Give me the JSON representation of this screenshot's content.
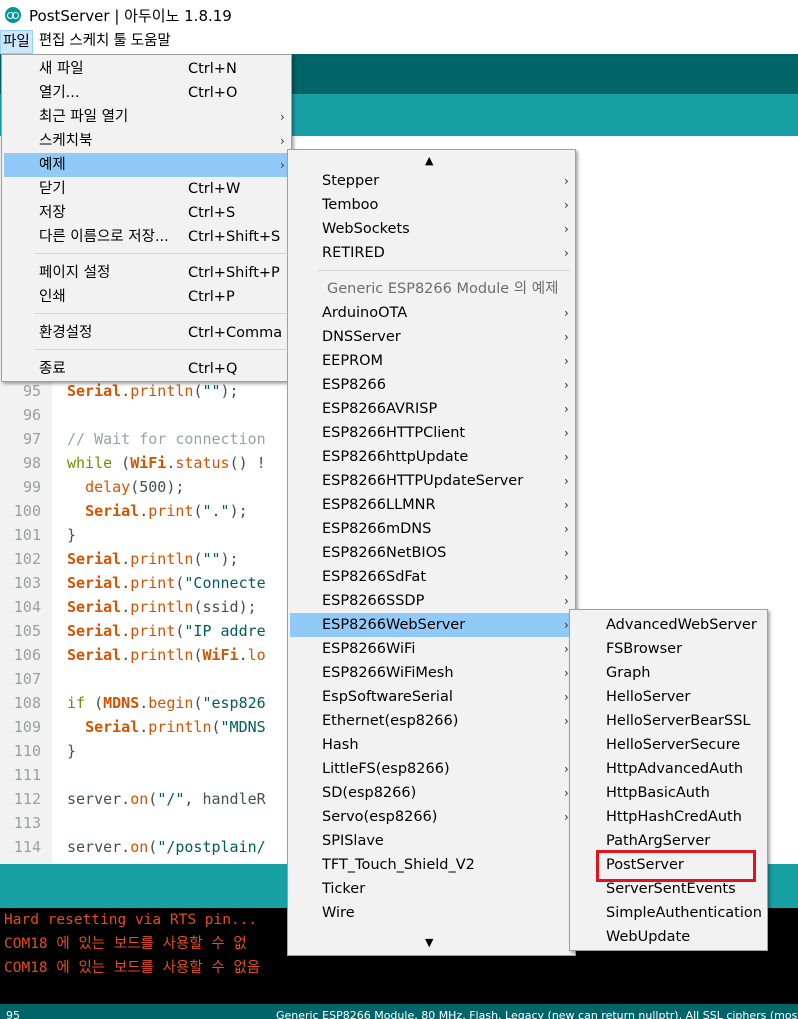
{
  "window": {
    "title": "PostServer | 아두이노 1.8.19"
  },
  "menubar": {
    "items": [
      "파일",
      "편집",
      "스케치",
      "툴",
      "도움말"
    ]
  },
  "editor": {
    "lines": [
      {
        "n": "95",
        "code": [
          [
            "kw-serial",
            "Serial"
          ],
          [
            "",
            "."
          ],
          [
            "kw-fn",
            "println"
          ],
          [
            "",
            "("
          ],
          [
            "str",
            "\"\""
          ],
          [
            "",
            ");"
          ]
        ]
      },
      {
        "n": "96",
        "code": []
      },
      {
        "n": "97",
        "code": [
          [
            "cmt",
            "// Wait for connection"
          ]
        ]
      },
      {
        "n": "98",
        "code": [
          [
            "kw-ctl",
            "while"
          ],
          [
            "",
            " ("
          ],
          [
            "kw-serial",
            "WiFi"
          ],
          [
            "",
            "."
          ],
          [
            "kw-fn",
            "status"
          ],
          [
            "",
            "() !"
          ]
        ]
      },
      {
        "n": "99",
        "code": [
          [
            "",
            "  "
          ],
          [
            "kw-fn",
            "delay"
          ],
          [
            "",
            "(500);"
          ]
        ]
      },
      {
        "n": "100",
        "code": [
          [
            "",
            "  "
          ],
          [
            "kw-serial",
            "Serial"
          ],
          [
            "",
            "."
          ],
          [
            "kw-fn",
            "print"
          ],
          [
            "",
            "("
          ],
          [
            "str",
            "\".\""
          ],
          [
            "",
            ");"
          ]
        ]
      },
      {
        "n": "101",
        "code": [
          [
            "",
            "}"
          ]
        ]
      },
      {
        "n": "102",
        "code": [
          [
            "kw-serial",
            "Serial"
          ],
          [
            "",
            "."
          ],
          [
            "kw-fn",
            "println"
          ],
          [
            "",
            "("
          ],
          [
            "str",
            "\"\""
          ],
          [
            "",
            ");"
          ]
        ]
      },
      {
        "n": "103",
        "code": [
          [
            "kw-serial",
            "Serial"
          ],
          [
            "",
            "."
          ],
          [
            "kw-fn",
            "print"
          ],
          [
            "",
            "("
          ],
          [
            "str",
            "\"Connecte"
          ]
        ]
      },
      {
        "n": "104",
        "code": [
          [
            "kw-serial",
            "Serial"
          ],
          [
            "",
            "."
          ],
          [
            "kw-fn",
            "println"
          ],
          [
            "",
            "(ssid);"
          ]
        ]
      },
      {
        "n": "105",
        "code": [
          [
            "kw-serial",
            "Serial"
          ],
          [
            "",
            "."
          ],
          [
            "kw-fn",
            "print"
          ],
          [
            "",
            "("
          ],
          [
            "str",
            "\"IP addre"
          ]
        ]
      },
      {
        "n": "106",
        "code": [
          [
            "kw-serial",
            "Serial"
          ],
          [
            "",
            "."
          ],
          [
            "kw-fn",
            "println"
          ],
          [
            "",
            "("
          ],
          [
            "kw-serial",
            "WiFi"
          ],
          [
            "",
            "."
          ],
          [
            "kw-fn",
            "lo"
          ]
        ]
      },
      {
        "n": "107",
        "code": []
      },
      {
        "n": "108",
        "code": [
          [
            "kw-ctl",
            "if"
          ],
          [
            "",
            " ("
          ],
          [
            "kw-serial",
            "MDNS"
          ],
          [
            "",
            "."
          ],
          [
            "kw-fn",
            "begin"
          ],
          [
            "",
            "("
          ],
          [
            "str",
            "\"esp826"
          ]
        ]
      },
      {
        "n": "109",
        "code": [
          [
            "",
            "  "
          ],
          [
            "kw-serial",
            "Serial"
          ],
          [
            "",
            "."
          ],
          [
            "kw-fn",
            "println"
          ],
          [
            "",
            "("
          ],
          [
            "str",
            "\"MDNS"
          ]
        ]
      },
      {
        "n": "110",
        "code": [
          [
            "",
            "}"
          ]
        ]
      },
      {
        "n": "111",
        "code": []
      },
      {
        "n": "112",
        "code": [
          [
            "",
            "server."
          ],
          [
            "kw-fn",
            "on"
          ],
          [
            "",
            "("
          ],
          [
            "str",
            "\"/\""
          ],
          [
            "",
            ", handleR"
          ]
        ]
      },
      {
        "n": "113",
        "code": []
      },
      {
        "n": "114",
        "code": [
          [
            "",
            "server."
          ],
          [
            "kw-fn",
            "on"
          ],
          [
            "",
            "("
          ],
          [
            "str",
            "\"/postplain/"
          ]
        ]
      }
    ]
  },
  "console": {
    "lines": [
      "Hard resetting via RTS pin...",
      "COM18 에 있는 보드를 사용할 수 없",
      "COM18 에 있는 보드를 사용할 수 없음"
    ]
  },
  "footer": {
    "line": "95",
    "board": "Generic ESP8266 Module, 80 MHz, Flash, Legacy (new can return nullptr), All SSL ciphers (most"
  },
  "file_menu": {
    "items": [
      {
        "label": "새 파일",
        "shortcut": "Ctrl+N"
      },
      {
        "label": "열기...",
        "shortcut": "Ctrl+O"
      },
      {
        "label": "최근 파일 열기",
        "shortcut": "",
        "submenu": true
      },
      {
        "label": "스케치북",
        "shortcut": "",
        "submenu": true
      },
      {
        "label": "예제",
        "shortcut": "",
        "submenu": true,
        "highlighted": true
      },
      {
        "label": "닫기",
        "shortcut": "Ctrl+W"
      },
      {
        "label": "저장",
        "shortcut": "Ctrl+S"
      },
      {
        "label": "다른 이름으로 저장...",
        "shortcut": "Ctrl+Shift+S"
      },
      {
        "label": "페이지 설정",
        "shortcut": "Ctrl+Shift+P"
      },
      {
        "label": "인쇄",
        "shortcut": "Ctrl+P"
      },
      {
        "label": "환경설정",
        "shortcut": "Ctrl+Comma"
      },
      {
        "label": "종료",
        "shortcut": "Ctrl+Q"
      }
    ]
  },
  "examples_menu": {
    "scroll_up": "▲",
    "scroll_down": "▼",
    "top_items": [
      "Stepper",
      "Temboo",
      "WebSockets",
      "RETIRED"
    ],
    "section_header": "Generic ESP8266 Module 의 예제",
    "board_items": [
      "ArduinoOTA",
      "DNSServer",
      "EEPROM",
      "ESP8266",
      "ESP8266AVRISP",
      "ESP8266HTTPClient",
      "ESP8266httpUpdate",
      "ESP8266HTTPUpdateServer",
      "ESP8266LLMNR",
      "ESP8266mDNS",
      "ESP8266NetBIOS",
      "ESP8266SdFat",
      "ESP8266SSDP",
      "ESP8266WebServer",
      "ESP8266WiFi",
      "ESP8266WiFiMesh",
      "EspSoftwareSerial",
      "Ethernet(esp8266)",
      "Hash",
      "LittleFS(esp8266)",
      "SD(esp8266)",
      "Servo(esp8266)",
      "SPISlave",
      "TFT_Touch_Shield_V2",
      "Ticker",
      "Wire"
    ],
    "highlighted": "ESP8266WebServer",
    "no_arrow": [
      "Hash",
      "SPISlave",
      "TFT_Touch_Shield_V2",
      "Ticker",
      "Wire"
    ]
  },
  "webserver_menu": {
    "items": [
      "AdvancedWebServer",
      "FSBrowser",
      "Graph",
      "HelloServer",
      "HelloServerBearSSL",
      "HelloServerSecure",
      "HttpAdvancedAuth",
      "HttpBasicAuth",
      "HttpHashCredAuth",
      "PathArgServer",
      "PostServer",
      "ServerSentEvents",
      "SimpleAuthentication",
      "WebUpdate"
    ],
    "marked": "PostServer"
  }
}
